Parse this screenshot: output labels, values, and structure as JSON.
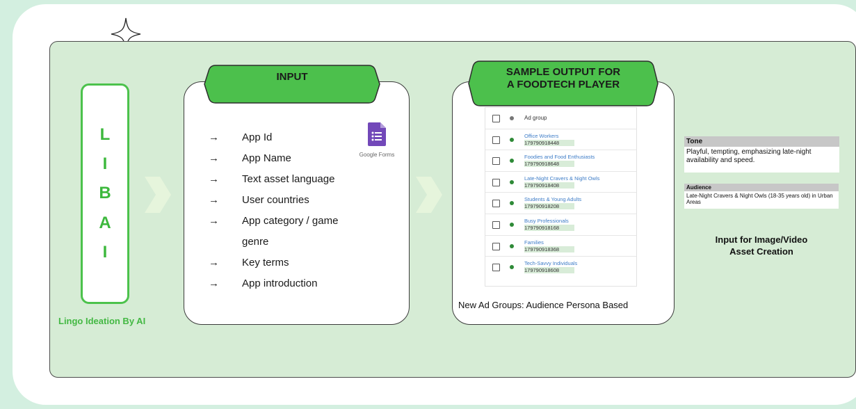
{
  "libai": {
    "letters": [
      "L",
      "I",
      "B",
      "A",
      "I"
    ],
    "caption": "Lingo Ideation By AI"
  },
  "input_card": {
    "title": "INPUT",
    "items": [
      "App Id",
      "App Name",
      "Text asset language",
      "User countries",
      "App category / game",
      "genre",
      "Key terms",
      "App introduction"
    ],
    "arrows": [
      true,
      true,
      true,
      true,
      true,
      false,
      true,
      true
    ],
    "logo_label": "Google Forms"
  },
  "output_card": {
    "title_line1": "SAMPLE OUTPUT FOR",
    "title_line2": "A FOODTECH PLAYER",
    "table_header": "Ad group",
    "rows": [
      {
        "name": "Office Workers",
        "id": "179790918448"
      },
      {
        "name": "Foodies and Food Enthusiasts",
        "id": "179790918648"
      },
      {
        "name": "Late-Night Cravers & Night Owls",
        "id": "179790918408"
      },
      {
        "name": "Students & Young Adults",
        "id": "179790918208"
      },
      {
        "name": "Busy Professionals",
        "id": "179790918168"
      },
      {
        "name": "Families",
        "id": "179790918368"
      },
      {
        "name": "Tech-Savvy Individuals",
        "id": "179790918608"
      }
    ],
    "caption": "New Ad Groups: Audience Persona Based"
  },
  "tone": {
    "heading": "Tone",
    "body": "Playful, tempting, emphasizing late-night availability and speed."
  },
  "audience": {
    "heading": "Audience",
    "body": "Late-Night Cravers & Night Owls (18-35 years old) in Urban Areas"
  },
  "right_caption": {
    "line1": "Input for Image/Video",
    "line2": "Asset Creation"
  },
  "colors": {
    "background": "#d3efe0",
    "panel": "#d6ecd5",
    "accent_green": "#3db83d",
    "banner_green": "#4cc04c",
    "chevron": "#e6f5dc"
  }
}
